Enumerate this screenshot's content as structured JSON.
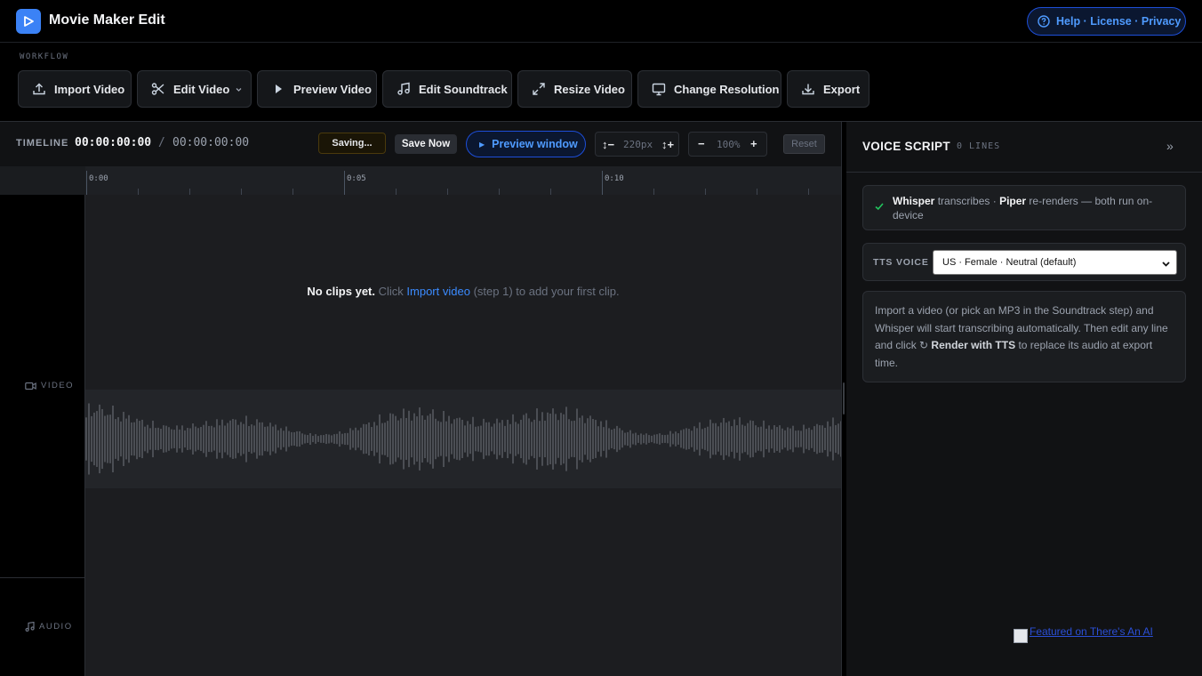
{
  "app": {
    "title": "Movie Maker Edit",
    "help_links": "Help · License · Privacy"
  },
  "workflow": {
    "label": "WORKFLOW",
    "buttons": [
      {
        "label": "Import Video",
        "icon": "upload-icon"
      },
      {
        "label": "Edit Video",
        "icon": "scissors-icon"
      },
      {
        "label": "Preview Video",
        "icon": "play-icon"
      },
      {
        "label": "Edit Soundtrack",
        "icon": "music-note-icon"
      },
      {
        "label": "Resize Video",
        "icon": "expand-icon"
      },
      {
        "label": "Change Resolution",
        "icon": "monitor-icon"
      },
      {
        "label": "Export",
        "icon": "download-icon"
      }
    ]
  },
  "timeline": {
    "label": "TIMELINE",
    "current_time": "00:00:00:00",
    "separator": "/",
    "total_time": "00:00:00:00",
    "saving_label": "Saving...",
    "save_now_label": "Save Now",
    "preview_window_label": "Preview window",
    "track_height": {
      "decrease": "↕−",
      "value": "220px",
      "increase": "↕+"
    },
    "zoom": {
      "decrease": "−",
      "value": "100%",
      "increase": "+"
    },
    "reset_label": "Reset",
    "ruler_ticks": [
      "0:00",
      "0:05",
      "0:10"
    ],
    "tracks": {
      "video": "VIDEO",
      "audio": "AUDIO"
    },
    "empty": {
      "bold": "No clips yet.",
      "pre": "Click",
      "link": "Import video",
      "post": "(step 1) to add your first clip."
    }
  },
  "voice_script": {
    "title": "VOICE SCRIPT",
    "count": "0 LINES",
    "collapse_glyph": "»",
    "info": {
      "whisper": "Whisper",
      "t1": "transcribes ·",
      "piper": "Piper",
      "t2": "re-renders — both run on-device"
    },
    "tts": {
      "label": "TTS VOICE",
      "selected": "US · Female · Neutral (default)"
    },
    "help": {
      "t1": "Import a video (or pick an MP3 in the Soundtrack step) and Whisper will start transcribing automatically. Then edit any line and click ↻",
      "bold": "Render with TTS",
      "t2": "to replace its audio at export time."
    }
  },
  "badge": {
    "text": "Featured on There's An AI"
  },
  "colors": {
    "accent": "#3b82f6",
    "link": "#4f9bff",
    "success": "#22c55e",
    "background": "#000000",
    "panel": "#111214"
  }
}
